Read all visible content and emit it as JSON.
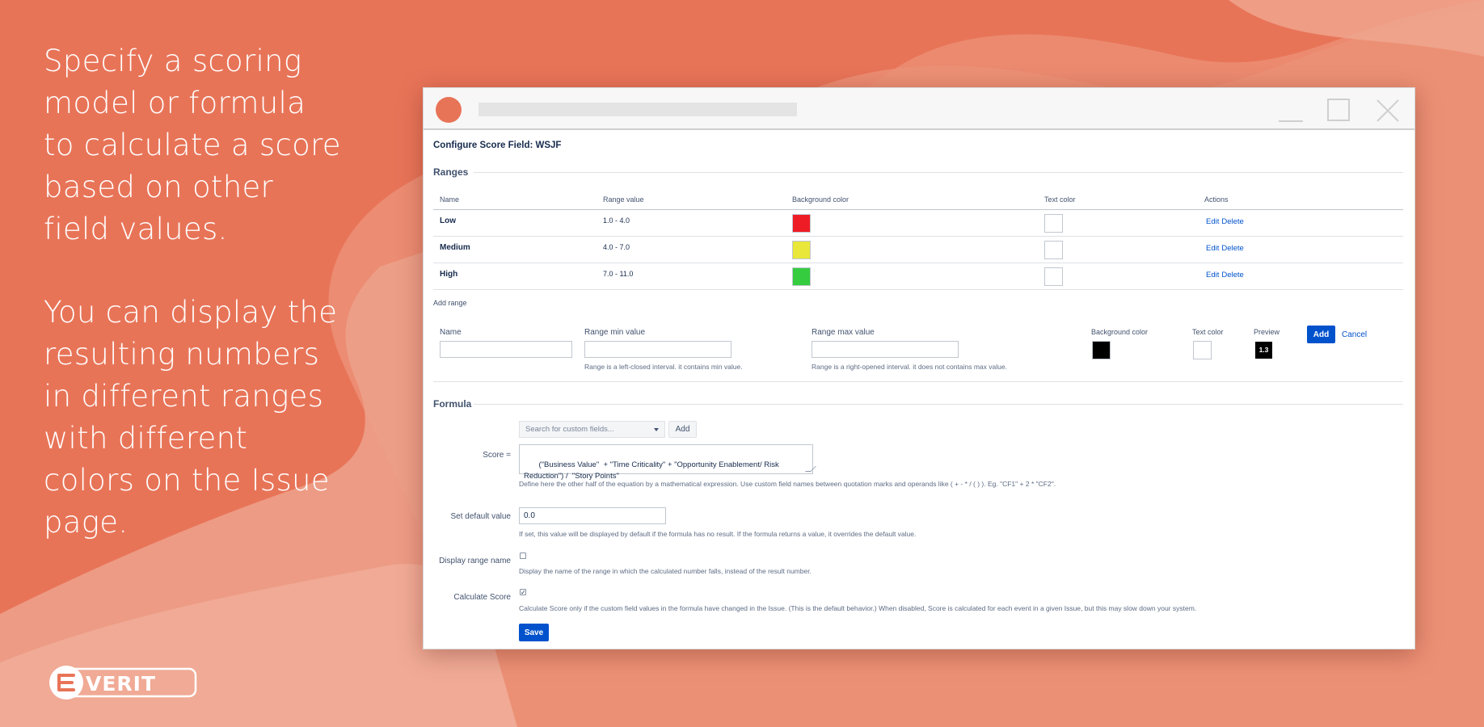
{
  "promo": {
    "paragraph_1": "Specify a scoring model or formula to calculate a score based on other field values.",
    "paragraph_2": "You can display the resulting numbers in different ranges with different colors on the Issue page."
  },
  "brand": {
    "logo_text": "EVERIT"
  },
  "colors": {
    "background": "#e87458",
    "primary_button": "#0052cc",
    "low": "#ee1c25",
    "medium": "#e8e73a",
    "high": "#35cc3f"
  },
  "page": {
    "title": "Configure Score Field: WSJF"
  },
  "ranges": {
    "section_title": "Ranges",
    "columns": {
      "name": "Name",
      "range_value": "Range value",
      "background_color": "Background color",
      "text_color": "Text color",
      "actions": "Actions"
    },
    "rows": [
      {
        "name": "Low",
        "range": "1.0 - 4.0",
        "bg": "#ee1c25",
        "text_color": "#ffffff",
        "edit": "Edit",
        "delete": "Delete"
      },
      {
        "name": "Medium",
        "range": "4.0 - 7.0",
        "bg": "#e8e73a",
        "text_color": "#ffffff",
        "edit": "Edit",
        "delete": "Delete"
      },
      {
        "name": "High",
        "range": "7.0 - 11.0",
        "bg": "#35cc3f",
        "text_color": "#ffffff",
        "edit": "Edit",
        "delete": "Delete"
      }
    ]
  },
  "add_range": {
    "title": "Add range",
    "name_label": "Name",
    "name_value": "",
    "min_label": "Range min value",
    "min_value": "",
    "min_help": "Range is a left-closed interval. it contains min value.",
    "max_label": "Range max value",
    "max_value": "",
    "max_help": "Range is a right-opened interval. it does not contains max value.",
    "bg_label": "Background color",
    "bg_value": "#000000",
    "text_color_label": "Text color",
    "text_color_value": "#ffffff",
    "preview_label": "Preview",
    "preview_value": "1.3",
    "add_button": "Add",
    "cancel_link": "Cancel"
  },
  "formula": {
    "section_title": "Formula",
    "search_placeholder": "Search for custom fields...",
    "add_button": "Add",
    "score_label": "Score =",
    "score_value": " (\"Business Value\"  + \"Time Criticality\" + \"Opportunity Enablement/ Risk\nReduction\") /  \"Story Points\"",
    "score_help": "Define here the other half of the equation by a mathematical expression. Use custom field names between quotation marks and operands like ( + - * / ( ) ). Eg. \"CF1\" + 2 * \"CF2\".",
    "default_label": "Set default value",
    "default_value": "0.0",
    "default_help": "If set, this value will be displayed by default if the formula has no result. If the formula returns a value, it overrides the default value.",
    "display_range_label": "Display range name",
    "display_range_checked": false,
    "display_range_help": "Display the name of the range in which the calculated number falls, instead of the result number.",
    "calculate_label": "Calculate Score",
    "calculate_checked": true,
    "calculate_help": "Calculate Score only if the custom field values in the formula have changed in the Issue. (This is the default behavior.) When disabled, Score is calculated for each event in a given Issue, but this may slow down your system.",
    "save_button": "Save"
  }
}
